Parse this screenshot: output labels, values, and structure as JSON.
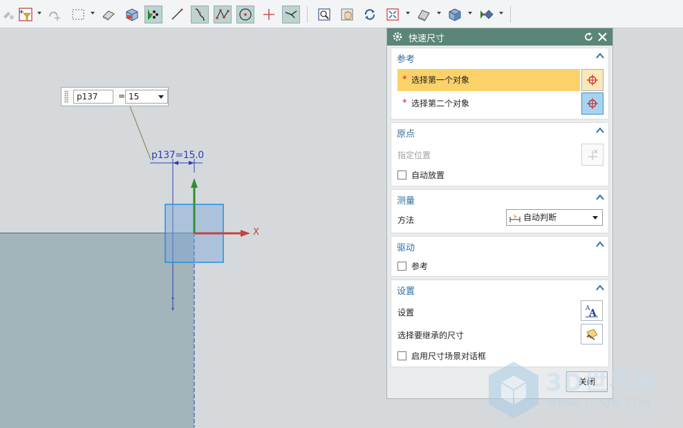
{
  "toolbar": {
    "tools": [
      {
        "name": "select-filter-icon"
      },
      {
        "name": "snap-icon"
      },
      {
        "name": "box-select-icon"
      },
      {
        "name": "eraser-icon"
      },
      {
        "name": "solid-view-icon"
      },
      {
        "name": "point-snap-icon"
      },
      {
        "name": "line-tool-icon"
      },
      {
        "name": "arc-tool-icon"
      },
      {
        "name": "spline-tool-icon"
      },
      {
        "name": "circle-tool-icon"
      },
      {
        "name": "point-tool-icon"
      },
      {
        "name": "trim-tool-icon"
      },
      {
        "name": "zoom-fit-icon"
      },
      {
        "name": "pan-icon"
      },
      {
        "name": "rotate-icon"
      },
      {
        "name": "zoom-window-icon"
      },
      {
        "name": "render-style-icon"
      },
      {
        "name": "shaded-cube-icon"
      },
      {
        "name": "view-orient-icon"
      }
    ]
  },
  "canvas": {
    "dim_name_value": "p137",
    "dim_equals": "=",
    "dim_value": "15",
    "dim_annotation": "p137=15.0",
    "axis_x_label": "X"
  },
  "dialog": {
    "title": "快速尺寸",
    "reference": {
      "header": "参考",
      "first_object": "选择第一个对象",
      "second_object": "选择第二个对象",
      "required_marker": "*"
    },
    "origin": {
      "header": "原点",
      "specify_position": "指定位置",
      "auto_place": "自动放置"
    },
    "measure": {
      "header": "测量",
      "method_label": "方法",
      "method_value": "自动判断"
    },
    "drive": {
      "header": "驱动",
      "reference_label": "参考"
    },
    "settings": {
      "header": "设置",
      "settings_label": "设置",
      "inherit_label": "选择要继承的尺寸",
      "enable_scene_dialog": "启用尺寸场景对话框"
    },
    "close_label": "关闭"
  },
  "watermark": {
    "brand": "3D世界网",
    "url": "WWW.3DSJW.COM"
  },
  "colors": {
    "title_bar": "#5b8578",
    "section_header": "#2f6fa5",
    "active_row": "#fbd26a",
    "dimension_blue": "#2a3fb5"
  }
}
